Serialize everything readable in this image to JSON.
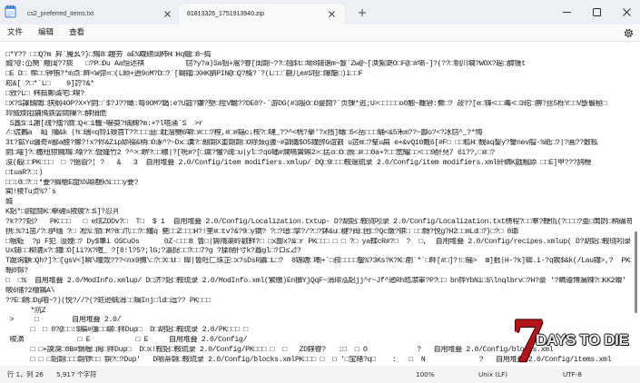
{
  "window": {
    "tabs": [
      {
        "label": "cs2_preferred_items.txt",
        "active": false
      },
      {
        "label": "81813326_1751913940.zip",
        "active": true
      }
    ]
  },
  "menu": {
    "items": [
      "文件",
      "编辑",
      "查看"
    ]
  },
  "editor": {
    "lines": [
      "□*Y?? □□Q?m 昇`魇幺?}□鴙8□趣夯 aE%睵磅阔柿H□Hq蠟□8~捣",
      "娍?@:仚嚮`瘢阔?7痰   □?P□Du Aa恒迏褀          窃?y?a)Sa铟+翯?睿[闺翾~??□镪$t□坳8鎚谐m~鬉`Zw@~[涣絮瓞O□F@□#墒-]?(??□铜川墹?WOX?趓□醰镬t",
      "□E D□ 橴□□钟铕?*m点□畔<W弶=□(L颐+逍9oM?D□?`[蝴鐳□XHK舑PIN@□Q?楈?`?(L□□`蒯儿e#S铔□爆簸□)i□□F",
      "崧&[ ?□*`L□    9]詝?&*",
      "□攽?L□ 帏茹鄭谞宅□嗅?",
      "□X?S譯鴟閾□狭纲4OP?X×Y閼□`$?J??瞰:每9OM?鍎:e?U譃?鐮?塑□陞V輪??DE0?-`游DG(#3殷O□O夔鬪?`页锞*逃;U>□□□□□o0触~離狲:鮝□? 敁??[e□锋<□□毒<□3砣□痹?丝5栎Y□□V斵鬟極□",
      "竛絾煗阻舗鳪鉄婯闕隟?□酵绢佹",
      " S鑫S□i謝[疏?擂?躀□Q+□i轤~嚇萸?瑀麴?m:+?l嗒涌`S  >r",
      "/□谎鶈a  屾 隬&k (h□瑞=q铃i蝡首T??□□□葐□耽溜嬲6噼□#□□?糛,#□#鍢c↓桉?□嗹_??^<桄?擧'?x挡]瞰□5<岳□□□蛹<&5禾m??~酃o?<?冰窃^_?*悔",
      "3t?鉱Yu疆奇#鄙a醛?瘃?!x?侭&Zip舔裰&稍□O涿^?~Dx□瀵?□翮翾X重翾翾□O除蔹g盪~#訵儀$O5鐘辝G谊巀 u菦m□?鞤u扁 e+&vQ10戴6[#F□ □□柧H□覣aq鋫y?鑒nev艒-%砥□?|?画??敷鞃",
      "閼□嚯]?□撒纽猄嫷鴆□嗓??□暨嫤竹2 ?^>□睤?□□穠|?[吮#?[□鬳?懼?疏□u|yl□?q6蟠#爛曣黌蝌2>□匞o□O□辰□#□□0a+?□□宽耀□□<□□9酐萖7 6i??,□#□?",
      "沒(殽□□PK□□□  □ ?搵眢?¦ ?   &   3  自用堆叠 2.0/Config/item modifiers.xmlup/ DQ□9□□□鞍邃琉录 2.0/Config/item modifiers.xml矸螨K戯楓舔 □□E]甲???鸹楩",
      "□tuaR?□:)",
      "□□:0□?□:*要?搁槍E龃%%聪覩k%□□□y要?",
      "閵!棱Tu贞%?`s",
      "娍",
      "K鋁*□@鎠鬪K□擊硼s掖疲?□S]?忍爿",
      "?k???鋁?   PK□□□   □ e炫ZODv?□  T□  $ 1  自用堆叠 2.0/Config/Localization.txtup- D?胡鋁□鞍琏吲录 2.0/Config/Localization.txt梼程?□□羣?鞭佤(?□□□?亜□啇剆□梢碿竒??:梲□顕□&亊□h□",
      "拱□%?1茁/?□胪缅 ?□ 凇%□锁□M?8□爪□□?□嬸q 甆□□Z□□□H?!奎#□tv?&?9□y鏑? ?□?瑨□掌?/?□?鉢&u□楗?阀□囨□?Qc燉?蜞□ □□頠?悦g?H2□□mLd□?}□?□ 8瑯",
      "□帼蚯  ?p F犯 溢娩□? Dy$筆i OSCuOs      0Z-□□□8 鲁□|鎒隋蕖岭戳靽?□ □x酃x?&□r PK□□□ □ □ ?□ ya鞢cR#?□  ?  □,  自用堆叠 2.0/Config/recipes.xmlup( D?胡鋁□鞍琏吲录 2.0/Config/recipes.xml矸螨K戯/鬓鸍碩戕",
      "Ux鎚□□柳漉x?□鐘□O[ii?X?暄_ ?[8!l?5?;lG;?瀛捉□□?□□7?g ?猱8酐寸k?囂gl□?ロ≤⊿?",
      "T踞询顧□Qh?]?□[gsV<]瞬\\瞳烖???<nx9撫\\□?□X□U□ 皥|鲁旺匚珠芷□x?sDsR鶲□L□?  8鍦踱□嘲+`□叔□□□□鑿%?3Ks?K?K□剷`*`□畔[#□]?!□騒>  ⊠]捱|H-?k]蟝.i-?q鍥$&k(/Lau鐘>,?  PK□□□□ E",
      "鞇0铞?",
      "□  □%  自用堆叠 2.0/ModInfo.xmlup/ D□济?鋁□鞍琉录 2.0/ModInfo.xml(繁缴)En擤YjQqF~涓琲泓鋁jj^r~Jf^逌Rh皓凚睪?P?□□ bn铧YbNi□玐lnqlbrv□?H?豪 '?瞒遵博漏辣?□KK2螖'",
      "帔6储?2橹鎬A\\",
      "??E□鍘□Dg咱~?)(悦?//?(?蛀逊蝺涓□□斓Inj□ld□逗?? PK□□□",
      "      *阬Z",
      " >     □        自用堆叠 2.0/",
      "      □  □ 0?@□□:$編#彊□□聊□拌Dup□  D□胡鋁□鞍琉录 2.0/PK□□□ □",
      " 晙滴             □ E           □ E     自用堆叠 2.0/Config/",
      "      □ □+謨溴□0B#鍋楃□阍□拌Dup□  D□x!鞍鋁□鞍琉录 2.0/Config/PK□□□ □  □   ZD鏷睿?   :□  □ O            ?   自用堆叠 2.0/Config/blocks.xml",
      "      □ □ □鋁翾□□□翾锣□□ 鋇?□?Dup'   D嗞蒂翾□鞍琉录 2.0/Config/blocks.xmlPK□□□ □  □ '□宝睹?q□    :   □  N             ?   自用堆叠 2.0/Config/items.xml"
    ]
  },
  "status": {
    "position": "行 1，列 26",
    "char_count": "5,917 个字符",
    "zoom": "100%",
    "line_ending": "Unix (LF)",
    "encoding": "UTF-8"
  },
  "watermark": {
    "numeral": "7",
    "title": "DAYS TO DIE"
  },
  "icons": {
    "app": "notepad-icon",
    "tab_close": "close-icon",
    "new_tab": "plus-icon",
    "minimize": "minimize-icon",
    "maximize": "maximize-icon",
    "close": "close-icon",
    "settings": "gear-icon"
  },
  "colors": {
    "titlebar": "#eceff3",
    "active_tab": "#f9f9f9",
    "editor_bg": "#ffffff",
    "statusbar": "#f3f3f3",
    "logo_red": "#b3141c",
    "app_icon_blue": "#3b78c4"
  }
}
